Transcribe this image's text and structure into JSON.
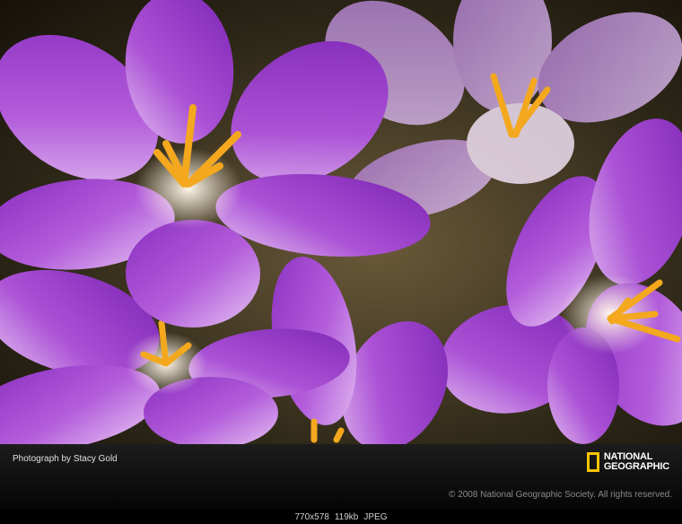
{
  "photo": {
    "subject": "purple-crocus-flowers",
    "colors": {
      "petal": "#9b3fc8",
      "petal_light": "#d9a8ef",
      "stamen": "#f3a81e",
      "background": "#3a3020"
    }
  },
  "credit_bar": {
    "credit": "Photograph by Stacy Gold",
    "logo_line1": "NATIONAL",
    "logo_line2": "GEOGRAPHIC",
    "copyright": "© 2008 National Geographic Society. All rights reserved.",
    "logo_frame_color": "#f5c400"
  },
  "status": {
    "dimensions": "770x578",
    "size": "119kb",
    "format": "JPEG"
  }
}
